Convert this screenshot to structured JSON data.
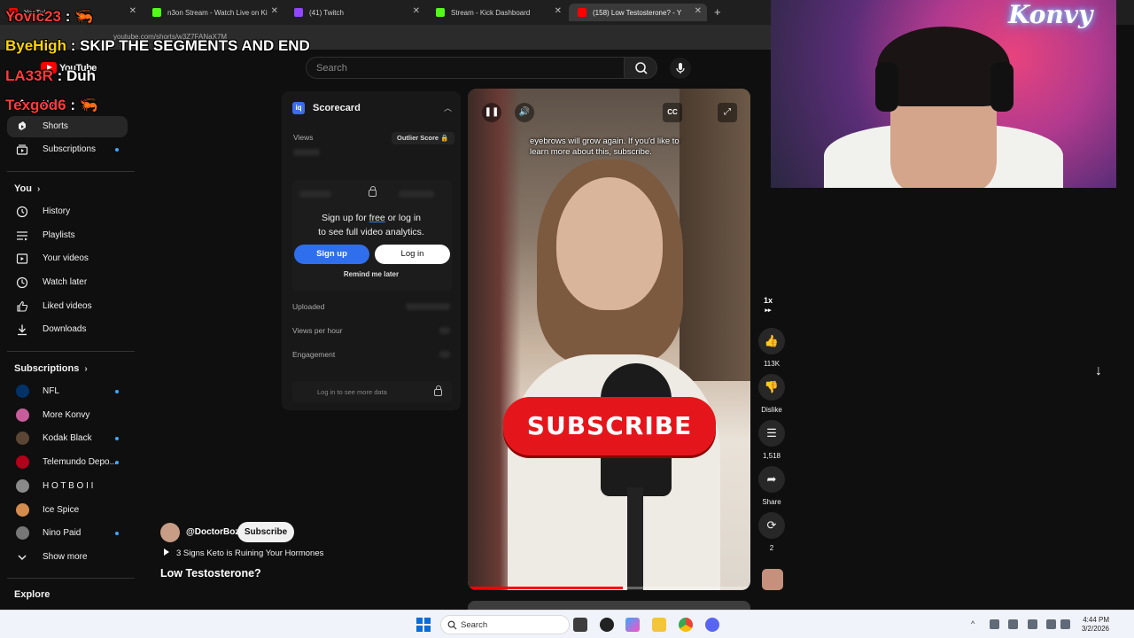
{
  "browser": {
    "tabs": [
      {
        "label": "YouTube",
        "color": "#ff0000"
      },
      {
        "label": "n3on Stream - Watch Live on Ki",
        "color": "#53fc18"
      },
      {
        "label": "(41) Twitch",
        "color": "#9146ff"
      },
      {
        "label": "Stream - Kick Dashboard",
        "color": "#53fc18"
      },
      {
        "label": "(158) Low Testosterone? - Y",
        "color": "#ff0000"
      }
    ],
    "url": "youtube.com/shorts/w3Z7FANaX7M"
  },
  "masthead": {
    "logo_text": "YouTube",
    "search_placeholder": "Search"
  },
  "sidebar": {
    "top_items": [
      {
        "label": "Home",
        "icon": "home-icon"
      },
      {
        "label": "Shorts",
        "icon": "shorts-icon"
      },
      {
        "label": "Subscriptions",
        "icon": "subscriptions-icon"
      }
    ],
    "you_heading": "You",
    "you_items": [
      {
        "label": "History",
        "icon": "history-icon"
      },
      {
        "label": "Playlists",
        "icon": "playlists-icon"
      },
      {
        "label": "Your videos",
        "icon": "your-videos-icon"
      },
      {
        "label": "Watch later",
        "icon": "watch-later-icon"
      },
      {
        "label": "Liked videos",
        "icon": "like-icon"
      },
      {
        "label": "Downloads",
        "icon": "download-icon"
      }
    ],
    "subs_heading": "Subscriptions",
    "subscriptions": [
      {
        "label": "NFL",
        "color": "#013369",
        "dot": true
      },
      {
        "label": "More Konvy",
        "color": "#c75d9a",
        "dot": false
      },
      {
        "label": "Kodak Black",
        "color": "#5b4636",
        "dot": true
      },
      {
        "label": "Telemundo Depo...",
        "color": "#b3001b",
        "dot": true
      },
      {
        "label": "H O T B O I I",
        "color": "#8a8a8a",
        "dot": false
      },
      {
        "label": "Ice Spice",
        "color": "#d48c4e",
        "dot": false
      },
      {
        "label": "Nino Paid",
        "color": "#777777",
        "dot": true
      }
    ],
    "show_more": "Show more",
    "explore_heading": "Explore"
  },
  "scorecard": {
    "title": "Scorecard",
    "views_label": "Views",
    "outlier_label": "Outlier Score",
    "signup_message_pre": "Sign up for ",
    "signup_message_link": "free",
    "signup_message_post": " or log in",
    "signup_message_line2": "to see full video analytics.",
    "signup_button": "Sign up",
    "login_button": "Log in",
    "remind_label": "Remind me later",
    "uploaded_label": "Uploaded",
    "vph_label": "Views per hour",
    "engagement_label": "Engagement",
    "footer_text": "Log in to see more data"
  },
  "video": {
    "caption": "eyebrows will grow again. If you'd like to learn more about this, subscribe.",
    "subscribe_overlay": "SUBSCRIBE",
    "cc_label": "CC",
    "progress": 0.55,
    "channel_handle": "@DoctorBoz",
    "subscribe_button": "Subscribe",
    "related_label": "3 Signs Keto is Ruining Your Hormones",
    "title": "Low Testosterone?"
  },
  "actions": {
    "speed": "1x",
    "likes": "113K",
    "dislike": "Dislike",
    "comments": "1,518",
    "share": "Share",
    "remix": "2"
  },
  "stream": {
    "neon_sign": "Konvy",
    "chat": [
      {
        "user": "Yovic23",
        "msg": " : 🦐",
        "color": "#ff3b3b"
      },
      {
        "user": "ByeHigh",
        "msg": " : SKIP THE SEGMENTS AND END",
        "color": "#ffd400"
      },
      {
        "user": "LA33R",
        "msg": " : Duh",
        "color": "#ff3b3b"
      },
      {
        "user": "Texgod6",
        "msg": " : 🦐",
        "color": "#ff3b3b"
      }
    ]
  },
  "taskbar": {
    "search_label": "Search",
    "time": "4:44 PM",
    "date": "3/2/2026"
  }
}
